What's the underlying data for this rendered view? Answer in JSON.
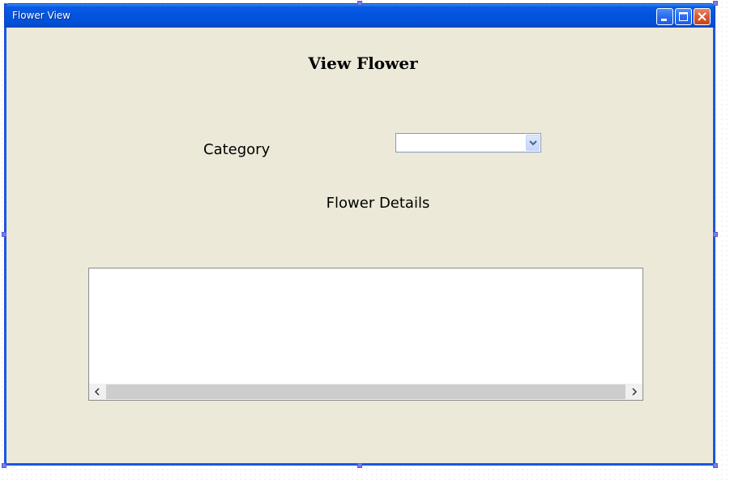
{
  "window": {
    "title": "Flower View"
  },
  "form": {
    "heading": "View Flower",
    "category_label": "Category",
    "category_selected": "",
    "details_label": "Flower Details",
    "details_text": ""
  },
  "icons": {
    "minimize": "minimize-icon",
    "maximize": "maximize-icon",
    "close": "close-icon",
    "dropdown": "chevron-down-icon",
    "scroll_left": "chevron-left-icon",
    "scroll_right": "chevron-right-icon"
  },
  "colors": {
    "titlebar": "#0354e0",
    "frame": "#1c55e0",
    "client_background": "#ece9d8",
    "close_button": "#d9582f",
    "selection_handle": "#7b7bf0"
  }
}
